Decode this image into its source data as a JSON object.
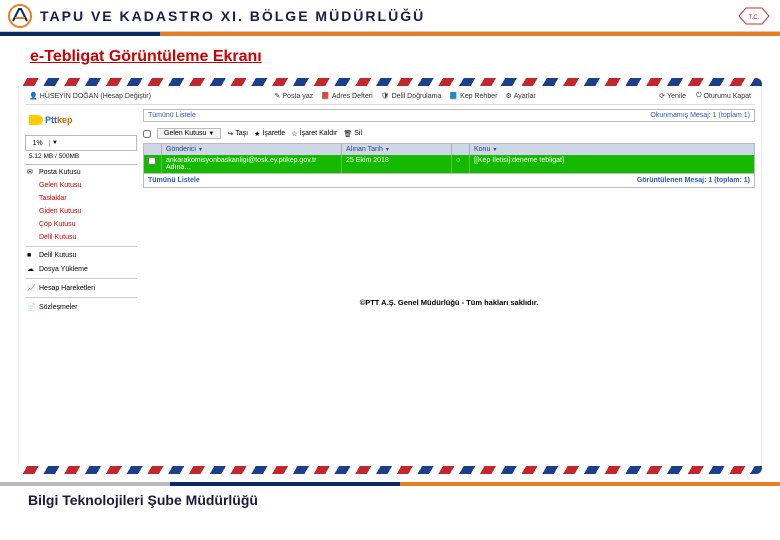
{
  "header": {
    "title": "TAPU VE KADASTRO XI. BÖLGE MÜDÜRLÜĞÜ"
  },
  "section_title": "e-Tebligat Görüntüleme Ekranı",
  "account": {
    "user_text": "HÜSEYİN DOĞAN (Hesap Değiştir)",
    "links": {
      "compose": "Posta yaz",
      "address": "Adres Defteri",
      "verify": "Delil Doğrulama",
      "guide": "Kep Rehber",
      "settings": "Ayarlar"
    },
    "right": {
      "refresh": "Yenile",
      "close": "Oturumu Kapat"
    }
  },
  "ptt_logo": {
    "brand": "Ptt",
    "suffix": "kep"
  },
  "sidebar": {
    "percent_label": "1%",
    "quota": "5.12 MB / 500MB",
    "folders": [
      {
        "icon": "✉",
        "label": "Posta Kutusu",
        "cls": ""
      },
      {
        "icon": "",
        "label": "Gelen Kutusu",
        "cls": "red"
      },
      {
        "icon": "",
        "label": "Taslaklar",
        "cls": "red"
      },
      {
        "icon": "",
        "label": "Giden Kutusu",
        "cls": "red"
      },
      {
        "icon": "",
        "label": "Çöp Kutusu",
        "cls": "red"
      },
      {
        "icon": "",
        "label": "Delil Kutusu",
        "cls": "red"
      }
    ],
    "utils": [
      {
        "icon": "■",
        "label": "Delil Kutusu"
      },
      {
        "icon": "☁",
        "label": "Dosya Yükleme"
      },
      {
        "icon": "📈",
        "label": "Hesap Hareketleri"
      },
      {
        "icon": "📄",
        "label": "Sözleşmeler"
      }
    ]
  },
  "main": {
    "view_all_label": "Tümünü Listele",
    "unread_text": "Okunmamış Mesaj: 1 (toplam 1)",
    "toolbar": {
      "inbox_btn": "Gelen Kutusu",
      "move": "Taşı",
      "mark": "İşaretle",
      "unmark": "İşaret Kaldır",
      "delete": "Sil"
    },
    "grid": {
      "headers": {
        "sender": "Gönderici",
        "date": "Alınan Tarih",
        "subject": "Konu"
      },
      "row": {
        "sender_line1": "ankarakomisyonbaskanligi@tosk.ey.ptikep.gov.tr",
        "sender_line2": "Adına…",
        "date": "25 Ekim 2018",
        "subject": "[[Kep İletisi]:deneme tebligat]"
      },
      "footer_left": "Tümünü Listele",
      "footer_right": "Görüntülenen Mesaj: 1 (toplam: 1)"
    }
  },
  "mail_footer": "©PTT A.Ş. Genel Müdürlüğü - Tüm hakları saklıdır.",
  "page_footer": "Bilgi Teknolojileri Şube Müdürlüğü"
}
